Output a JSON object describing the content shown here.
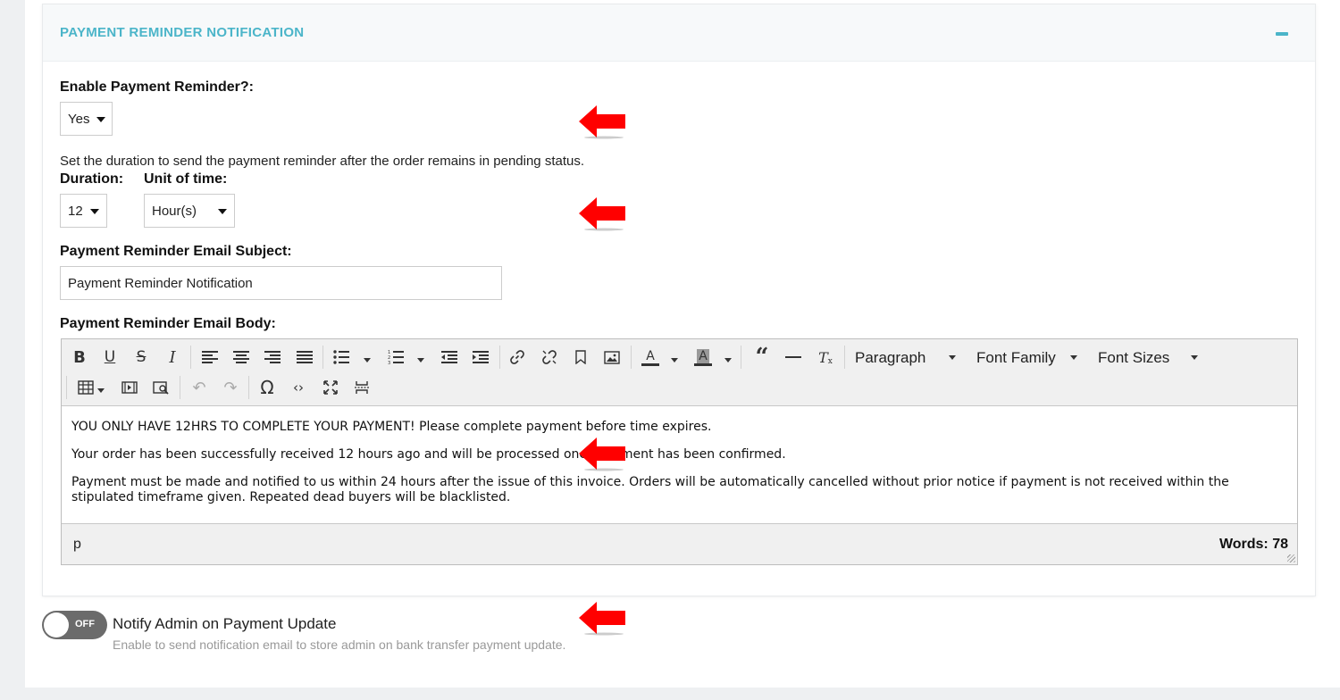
{
  "section": {
    "title": "PAYMENT REMINDER NOTIFICATION"
  },
  "enable": {
    "label": "Enable Payment Reminder?:",
    "value": "Yes"
  },
  "duration": {
    "help": "Set the duration to send the payment reminder after the order remains in pending status.",
    "duration_label": "Duration:",
    "duration_value": "12",
    "unit_label": "Unit of time:",
    "unit_value": "Hour(s)"
  },
  "subject": {
    "label": "Payment Reminder Email Subject:",
    "value": "Payment Reminder Notification"
  },
  "body": {
    "label": "Payment Reminder Email Body:",
    "toolbar": {
      "paragraph": "Paragraph",
      "font_family": "Font Family",
      "font_sizes": "Font Sizes"
    },
    "paragraphs": [
      "YOU ONLY HAVE 12HRS TO COMPLETE YOUR PAYMENT! Please complete payment before time expires.",
      "Your order has been successfully received 12 hours ago and will be processed once payment has been confirmed.",
      "Payment must be made and notified to us within 24 hours after the issue of this invoice. Orders will be automatically cancelled without prior notice if payment is not received within the stipulated timeframe given. Repeated dead buyers will be blacklisted."
    ],
    "path": "p",
    "word_count": "Words: 78"
  },
  "notify": {
    "toggle_state": "OFF",
    "label": "Notify Admin on Payment Update",
    "help": "Enable to send notification email to store admin on bank transfer payment update."
  },
  "colors": {
    "accent": "#4bb5c9",
    "annotation_arrow": "#ff0000"
  }
}
